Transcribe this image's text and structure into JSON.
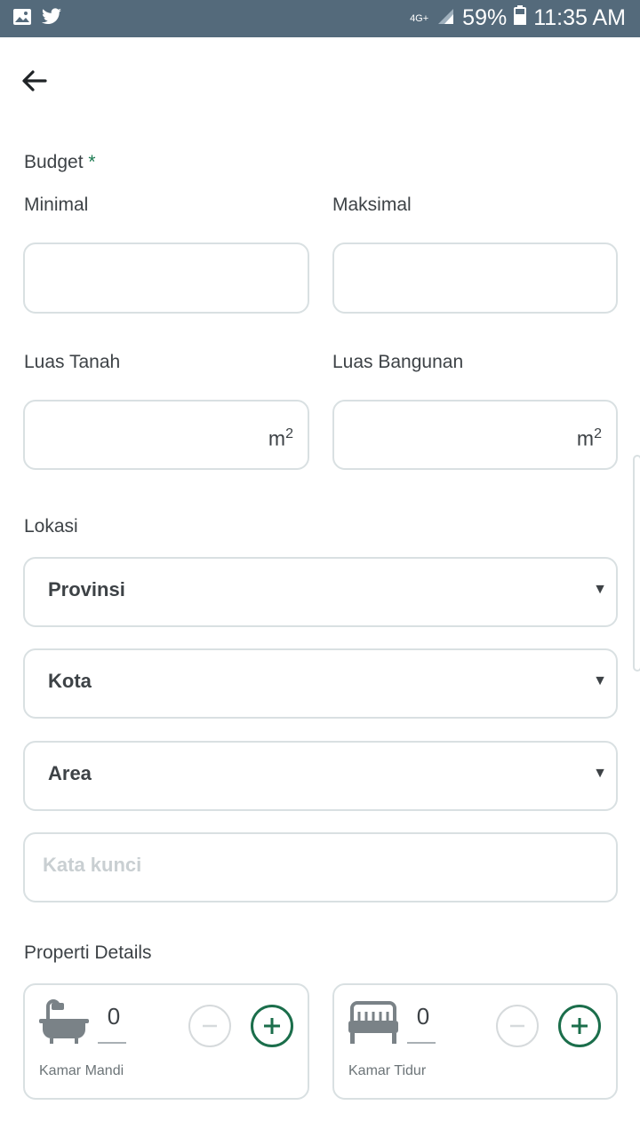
{
  "status_bar": {
    "network": "4G+",
    "battery": "59%",
    "time": "11:35 AM",
    "icons": [
      "image-icon",
      "twitter-icon",
      "signal-icon",
      "battery-icon"
    ]
  },
  "form": {
    "budget_label": "Budget",
    "required_mark": "*",
    "min_label": "Minimal",
    "max_label": "Maksimal",
    "min_value": "",
    "max_value": "",
    "land_label": "Luas Tanah",
    "building_label": "Luas Bangunan",
    "unit": "m",
    "unit_exp": "2",
    "location_label": "Lokasi",
    "province": "Provinsi",
    "city": "Kota",
    "area": "Area",
    "keyword_placeholder": "Kata kunci",
    "details_label": "Properti Details",
    "bathroom": {
      "value": "0",
      "label": "Kamar Mandi"
    },
    "bedroom": {
      "value": "0",
      "label": "Kamar Tidur"
    }
  },
  "colors": {
    "status_bar": "#546a7b",
    "accent": "#1b6e4b",
    "border": "#d9e0e2"
  }
}
